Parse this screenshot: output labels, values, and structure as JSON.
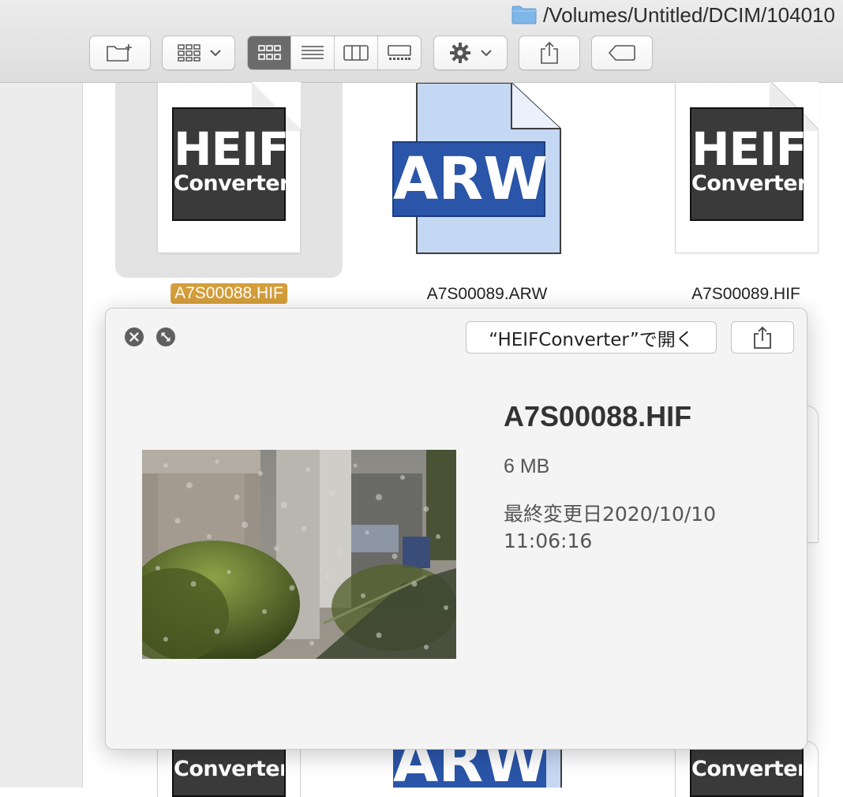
{
  "window": {
    "path": "/Volumes/Untitled/DCIM/104010"
  },
  "toolbar": {
    "icons": [
      "new-folder-icon",
      "group-icon",
      "chevron-down-icon",
      "icon-view-icon",
      "list-view-icon",
      "column-view-icon",
      "gallery-view-icon",
      "gear-icon",
      "share-icon",
      "tag-icon"
    ],
    "active_view": "icon",
    "active_color": "#6b6b6b"
  },
  "files": [
    {
      "name": "A7S00088.HIF",
      "type": "HEIF",
      "selected": true
    },
    {
      "name": "A7S00089.ARW",
      "type": "ARW",
      "selected": false
    },
    {
      "name": "A7S00089.HIF",
      "type": "HEIF",
      "selected": false
    }
  ],
  "file_icons": {
    "heif_line1": "HEIF",
    "heif_line2": "Converter",
    "arw_label": "ARW"
  },
  "selection_color": "#d59e3a",
  "quicklook": {
    "open_with_label": "“HEIFConverter”で開く",
    "file_name": "A7S00088.HIF",
    "file_size": "6 MB",
    "modified": "最終変更日2020/10/10 11:06:16"
  }
}
